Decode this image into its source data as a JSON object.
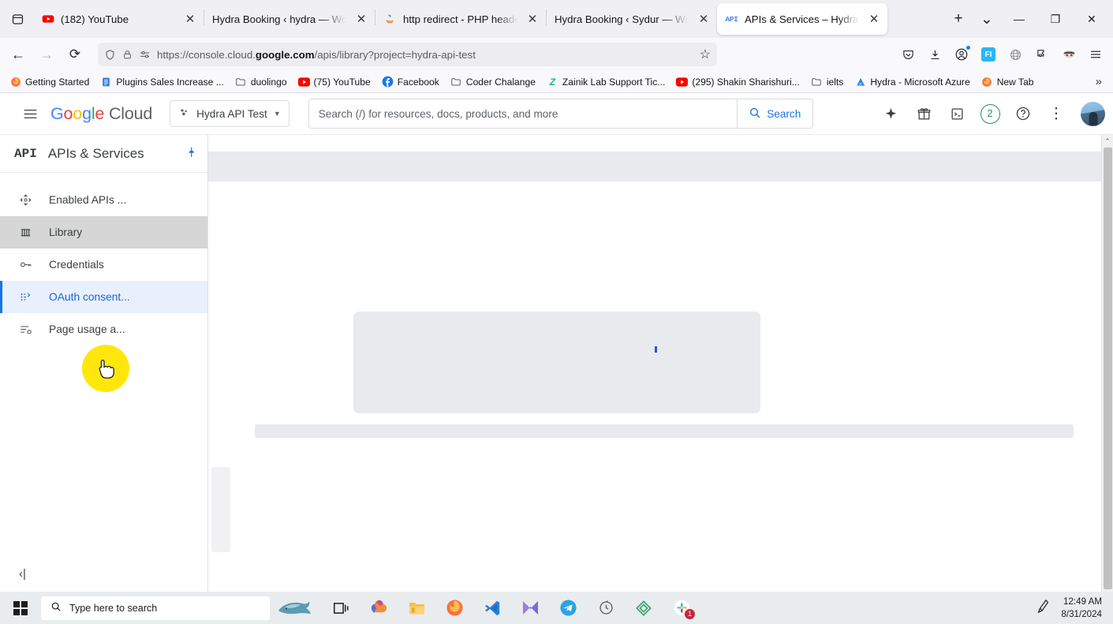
{
  "browser": {
    "tablist_icon": "tab-list-icon",
    "tabs": [
      {
        "label": "(182) YouTube",
        "icon": "youtube-icon",
        "active": false
      },
      {
        "label": "Hydra Booking ‹ hydra — WordPress",
        "icon": "blank-icon",
        "active": false
      },
      {
        "label": "http redirect - PHP header(Location...)",
        "icon": "java-icon",
        "active": false
      },
      {
        "label": "Hydra Booking ‹ Sydur — WordPress",
        "icon": "blank-icon",
        "active": false
      },
      {
        "label": "APIs & Services – Hydra API Test",
        "icon": "api-icon",
        "active": true
      }
    ],
    "close_glyph": "✕",
    "new_tab_label": "+",
    "tab_menu_label": "⌄",
    "window_controls": {
      "minimize": "—",
      "maximize": "❐",
      "close": "✕"
    },
    "nav": {
      "back": "←",
      "forward": "→",
      "reload": "⟳",
      "shield_icon": "tracking-shield-icon",
      "lock_icon": "padlock-icon",
      "permissions_icon": "site-permissions-icon",
      "url_prefix": "https://console.cloud.",
      "url_domain": "google.com",
      "url_suffix": "/apis/library?project=hydra-api-test",
      "bookmark_star": "☆"
    },
    "toolbar_icons": [
      "pocket-icon",
      "downloads-icon",
      "account-icon",
      "fi-extension-icon",
      "globe-extension-icon",
      "puzzle-extension-icon",
      "mask-extension-icon",
      "app-menu-icon"
    ],
    "bookmarks": [
      {
        "label": "Getting Started",
        "icon": "firefox-icon"
      },
      {
        "label": "Plugins Sales Increase ...",
        "icon": "sheet-icon"
      },
      {
        "label": "duolingo",
        "icon": "folder-icon"
      },
      {
        "label": "(75) YouTube",
        "icon": "youtube-icon"
      },
      {
        "label": "Facebook",
        "icon": "facebook-icon"
      },
      {
        "label": "Coder Chalange",
        "icon": "folder-icon"
      },
      {
        "label": "Zainik Lab Support Tic...",
        "icon": "zainik-icon"
      },
      {
        "label": "(295) Shakin Sharishuri...",
        "icon": "youtube-icon"
      },
      {
        "label": "ielts",
        "icon": "folder-icon"
      },
      {
        "label": "Hydra - Microsoft Azure",
        "icon": "azure-icon"
      },
      {
        "label": "New Tab",
        "icon": "firefox-icon"
      }
    ],
    "bookmarks_overflow": "»"
  },
  "gcloud": {
    "hamburger_icon": "hamburger-menu-icon",
    "logo_google": "Google",
    "logo_cloud": "Cloud",
    "project": {
      "label": "Hydra API Test",
      "icon": "project-dots-icon",
      "chevron": "▼"
    },
    "search": {
      "placeholder": "Search (/) for resources, docs, products, and more",
      "value": "",
      "button_label": "Search",
      "button_icon": "search-icon"
    },
    "header_icons": [
      {
        "name": "gemini-sparkle-icon",
        "glyph": "✦"
      },
      {
        "name": "gift-icon",
        "glyph": "gift"
      },
      {
        "name": "cloud-shell-icon",
        "glyph": "shell"
      },
      {
        "name": "notifications-icon",
        "glyph": "2"
      },
      {
        "name": "help-icon",
        "glyph": "?"
      },
      {
        "name": "more-options-icon",
        "glyph": "⋮"
      }
    ],
    "notification_count": "2",
    "avatar_name": "user-avatar"
  },
  "sidebar": {
    "product_glyph": "API",
    "title": "APIs & Services",
    "pin_icon": "pin-icon",
    "items": [
      {
        "label": "Enabled APIs ...",
        "icon": "dashboard-icon",
        "state": "normal"
      },
      {
        "label": "Library",
        "icon": "library-icon",
        "state": "hover"
      },
      {
        "label": "Credentials",
        "icon": "key-icon",
        "state": "normal"
      },
      {
        "label": "OAuth consent...",
        "icon": "oauth-icon",
        "state": "selected"
      },
      {
        "label": "Page usage a...",
        "icon": "page-usage-icon",
        "state": "normal"
      }
    ],
    "collapse_label": "‹|"
  },
  "main": {
    "state": "loading",
    "skeletons": [
      "top-bar",
      "hero-card",
      "wide-bar",
      "left-block"
    ],
    "loading_dot_color": "#2a56c6"
  },
  "scrollbar": {
    "up": "⌃",
    "down": "⌄"
  },
  "taskbar": {
    "start_icon": "windows-start-icon",
    "search": {
      "placeholder": "Type here to search",
      "icon": "search-icon"
    },
    "cortana_icon": "whale-sticker-icon",
    "apps": [
      {
        "name": "task-view-icon"
      },
      {
        "name": "copilot-icon"
      },
      {
        "name": "file-explorer-icon"
      },
      {
        "name": "firefox-icon"
      },
      {
        "name": "vscode-icon"
      },
      {
        "name": "movie-maker-icon"
      },
      {
        "name": "telegram-icon"
      },
      {
        "name": "clock-icon"
      },
      {
        "name": "diamond-app-icon"
      },
      {
        "name": "slack-icon",
        "badge": "1"
      }
    ],
    "tray_icon": "pen-tray-icon",
    "clock": {
      "time": "12:49 AM",
      "date": "8/31/2024"
    }
  }
}
